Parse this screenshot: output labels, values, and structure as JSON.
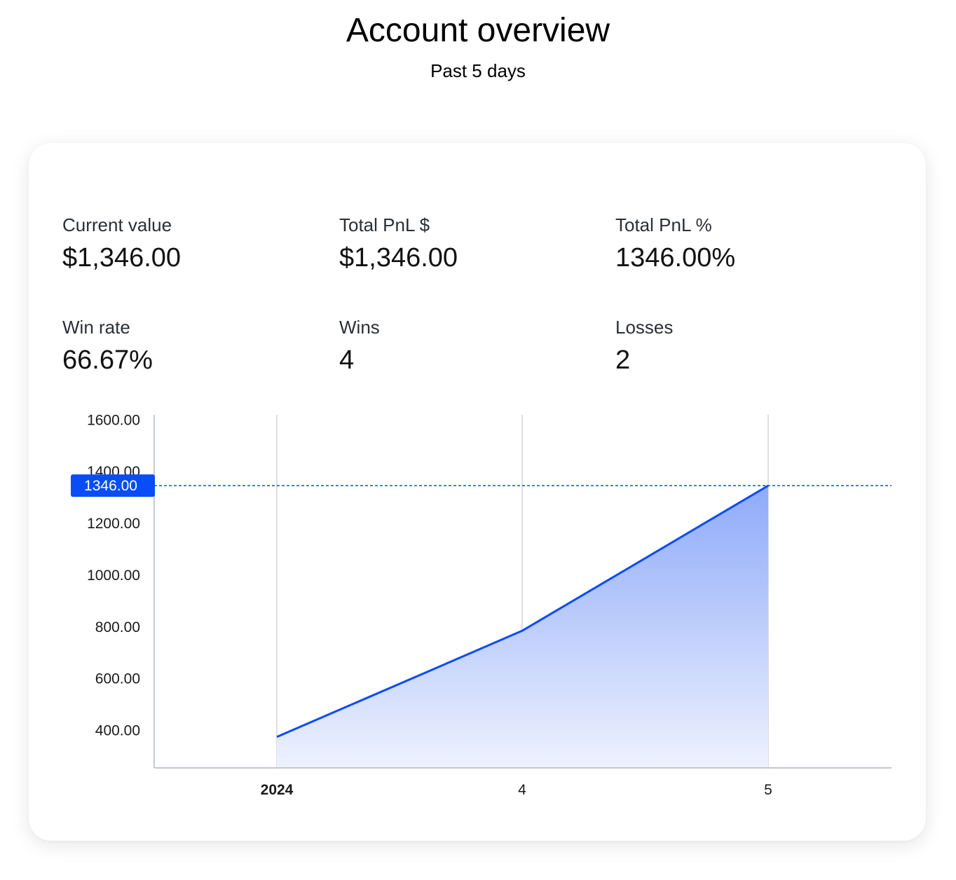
{
  "header": {
    "title": "Account overview",
    "subtitle": "Past 5 days"
  },
  "stats": [
    {
      "label": "Current value",
      "value": "$1,346.00"
    },
    {
      "label": "Total PnL $",
      "value": "$1,346.00"
    },
    {
      "label": "Total PnL %",
      "value": "1346.00%"
    },
    {
      "label": "Win rate",
      "value": "66.67%"
    },
    {
      "label": "Wins",
      "value": "4"
    },
    {
      "label": "Losses",
      "value": "2"
    }
  ],
  "colors": {
    "accent": "#0a4cf5",
    "fill_top": "#8eaaf9",
    "fill_bottom": "#eef2fe",
    "grid": "#d0d4da",
    "axis": "#c3c8cf"
  },
  "chart_data": {
    "type": "area",
    "x_labels": [
      "2024",
      "4",
      "5"
    ],
    "x_labels_bold": [
      true,
      false,
      false
    ],
    "values": [
      375,
      785,
      1346
    ],
    "y_ticks": [
      400,
      600,
      800,
      1000,
      1200,
      1400,
      1600
    ],
    "y_tick_labels": [
      "400.00",
      "600.00",
      "800.00",
      "1000.00",
      "1200.00",
      "1400.00",
      "1600.00"
    ],
    "ylim": [
      255,
      1620
    ],
    "last_value_label": "1346.00",
    "last_value": 1346,
    "grid": "vertical"
  }
}
